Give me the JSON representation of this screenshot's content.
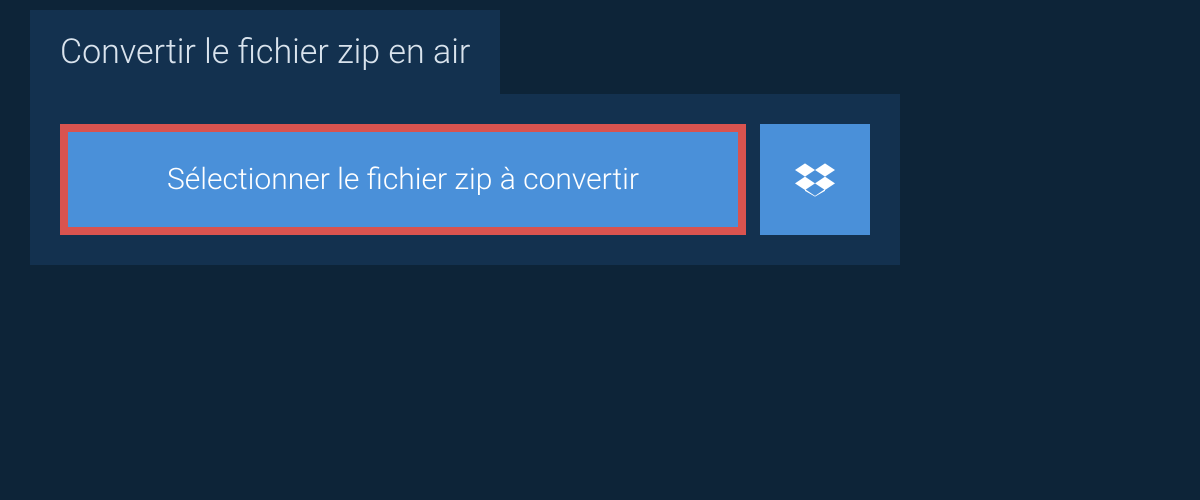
{
  "title": "Convertir le fichier zip en air",
  "buttons": {
    "select_file_label": "Sélectionner le fichier zip à convertir"
  },
  "colors": {
    "background": "#0d2438",
    "panel": "#13314f",
    "button_primary": "#4a90d9",
    "highlight_border": "#d9534f",
    "text_light": "#d9e3ed",
    "text_white": "#ffffff"
  }
}
